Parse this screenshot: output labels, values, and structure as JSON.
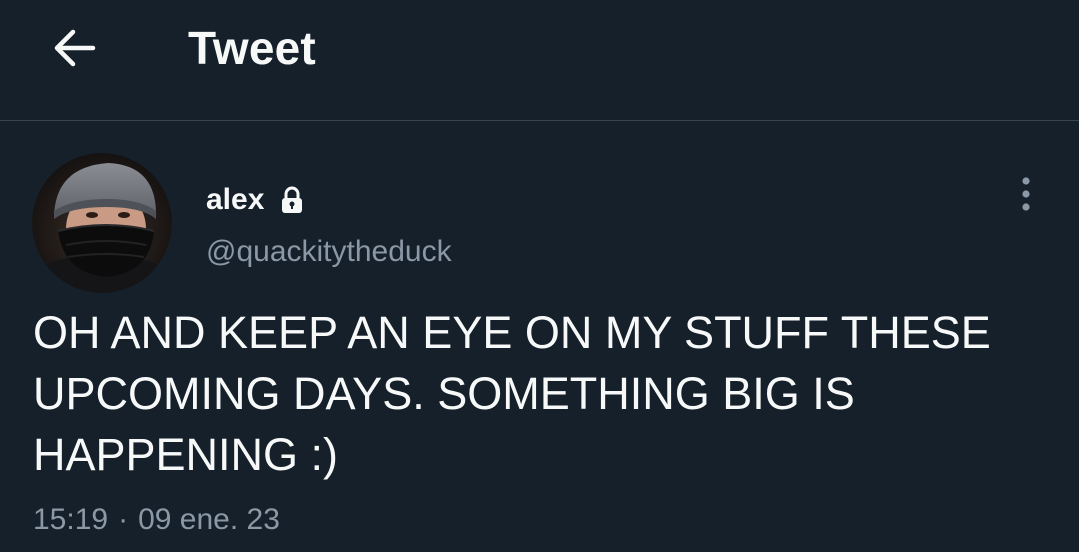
{
  "header": {
    "title": "Tweet",
    "back_icon": "arrow-left-icon"
  },
  "tweet": {
    "author": {
      "name": "alex",
      "handle": "@quackitytheduck",
      "protected_icon": "lock-icon",
      "avatar": "profile-photo"
    },
    "more_icon": "more-vertical-icon",
    "text": "OH AND KEEP AN EYE ON MY STUFF THESE\nUPCOMING DAYS. SOMETHING BIG IS\nHAPPENING :)",
    "time": "15:19",
    "separator": "·",
    "date": "09 ene. 23"
  },
  "colors": {
    "background": "#15202b",
    "primary_text": "#f7f9f9",
    "secondary_text": "#8b98a5",
    "divider": "#38444d"
  }
}
